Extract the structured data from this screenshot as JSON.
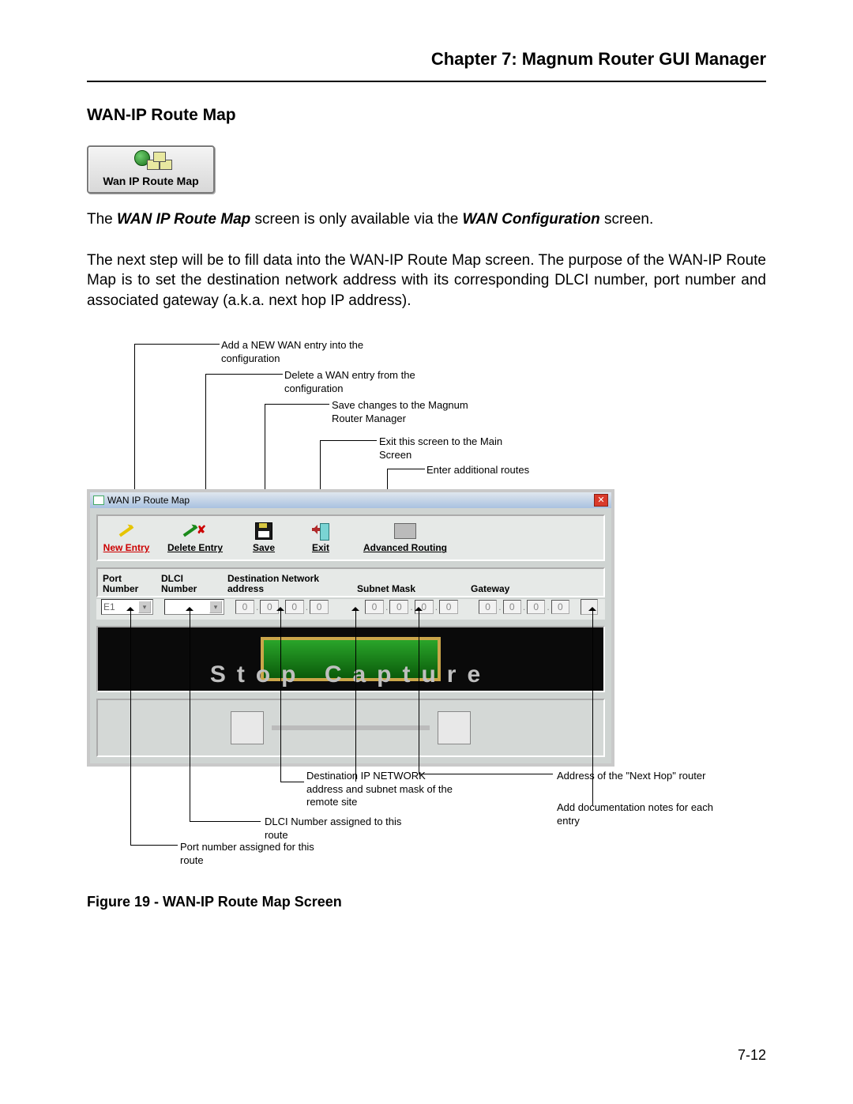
{
  "header": {
    "chapter": "Chapter 7: Magnum Router GUI Manager"
  },
  "section": {
    "title": "WAN-IP Route Map"
  },
  "icon_button": {
    "label": "Wan IP Route Map"
  },
  "intro": {
    "prefix": "The ",
    "bold1": "WAN IP Route Map",
    "mid1": " screen is only available via the ",
    "bold2": "WAN Configuration",
    "suffix": " screen."
  },
  "paragraph2": "The next step will be to fill data into the WAN-IP Route Map screen.  The purpose of the WAN-IP Route Map is to set the destination network address with its corresponding DLCI number, port number and associated gateway (a.k.a. next hop IP address).",
  "callouts_top": {
    "c1": "Add a NEW WAN entry into the configuration",
    "c2": "Delete a WAN entry from the configuration",
    "c3": "Save changes to the Magnum Router Manager",
    "c4": "Exit this screen to the Main Screen",
    "c5": "Enter additional routes"
  },
  "app_window": {
    "title": "WAN IP Route Map",
    "toolbar": {
      "new_entry": "New Entry",
      "delete_entry": "Delete Entry",
      "save": "Save",
      "exit": "Exit",
      "advanced": "Advanced Routing"
    },
    "headers": {
      "port": "Port Number",
      "dlci": "DLCI Number",
      "dest": "Destination Network address",
      "mask": "Subnet Mask",
      "gw": "Gateway"
    },
    "fields": {
      "port_value": "E1",
      "dlci_value": "",
      "oct": "0"
    },
    "decor_text": "Stop Capture"
  },
  "callouts_bottom": {
    "b1": "Port number assigned for this route",
    "b2": "DLCI Number assigned to this route",
    "b3": "Destination IP NETWORK address and subnet mask of  the remote site",
    "b4": "Address of the \"Next Hop\" router",
    "b5": "Add documentation notes for each entry"
  },
  "figure": {
    "caption": "Figure 19 - WAN-IP Route Map Screen"
  },
  "page": {
    "number": "7-12"
  }
}
